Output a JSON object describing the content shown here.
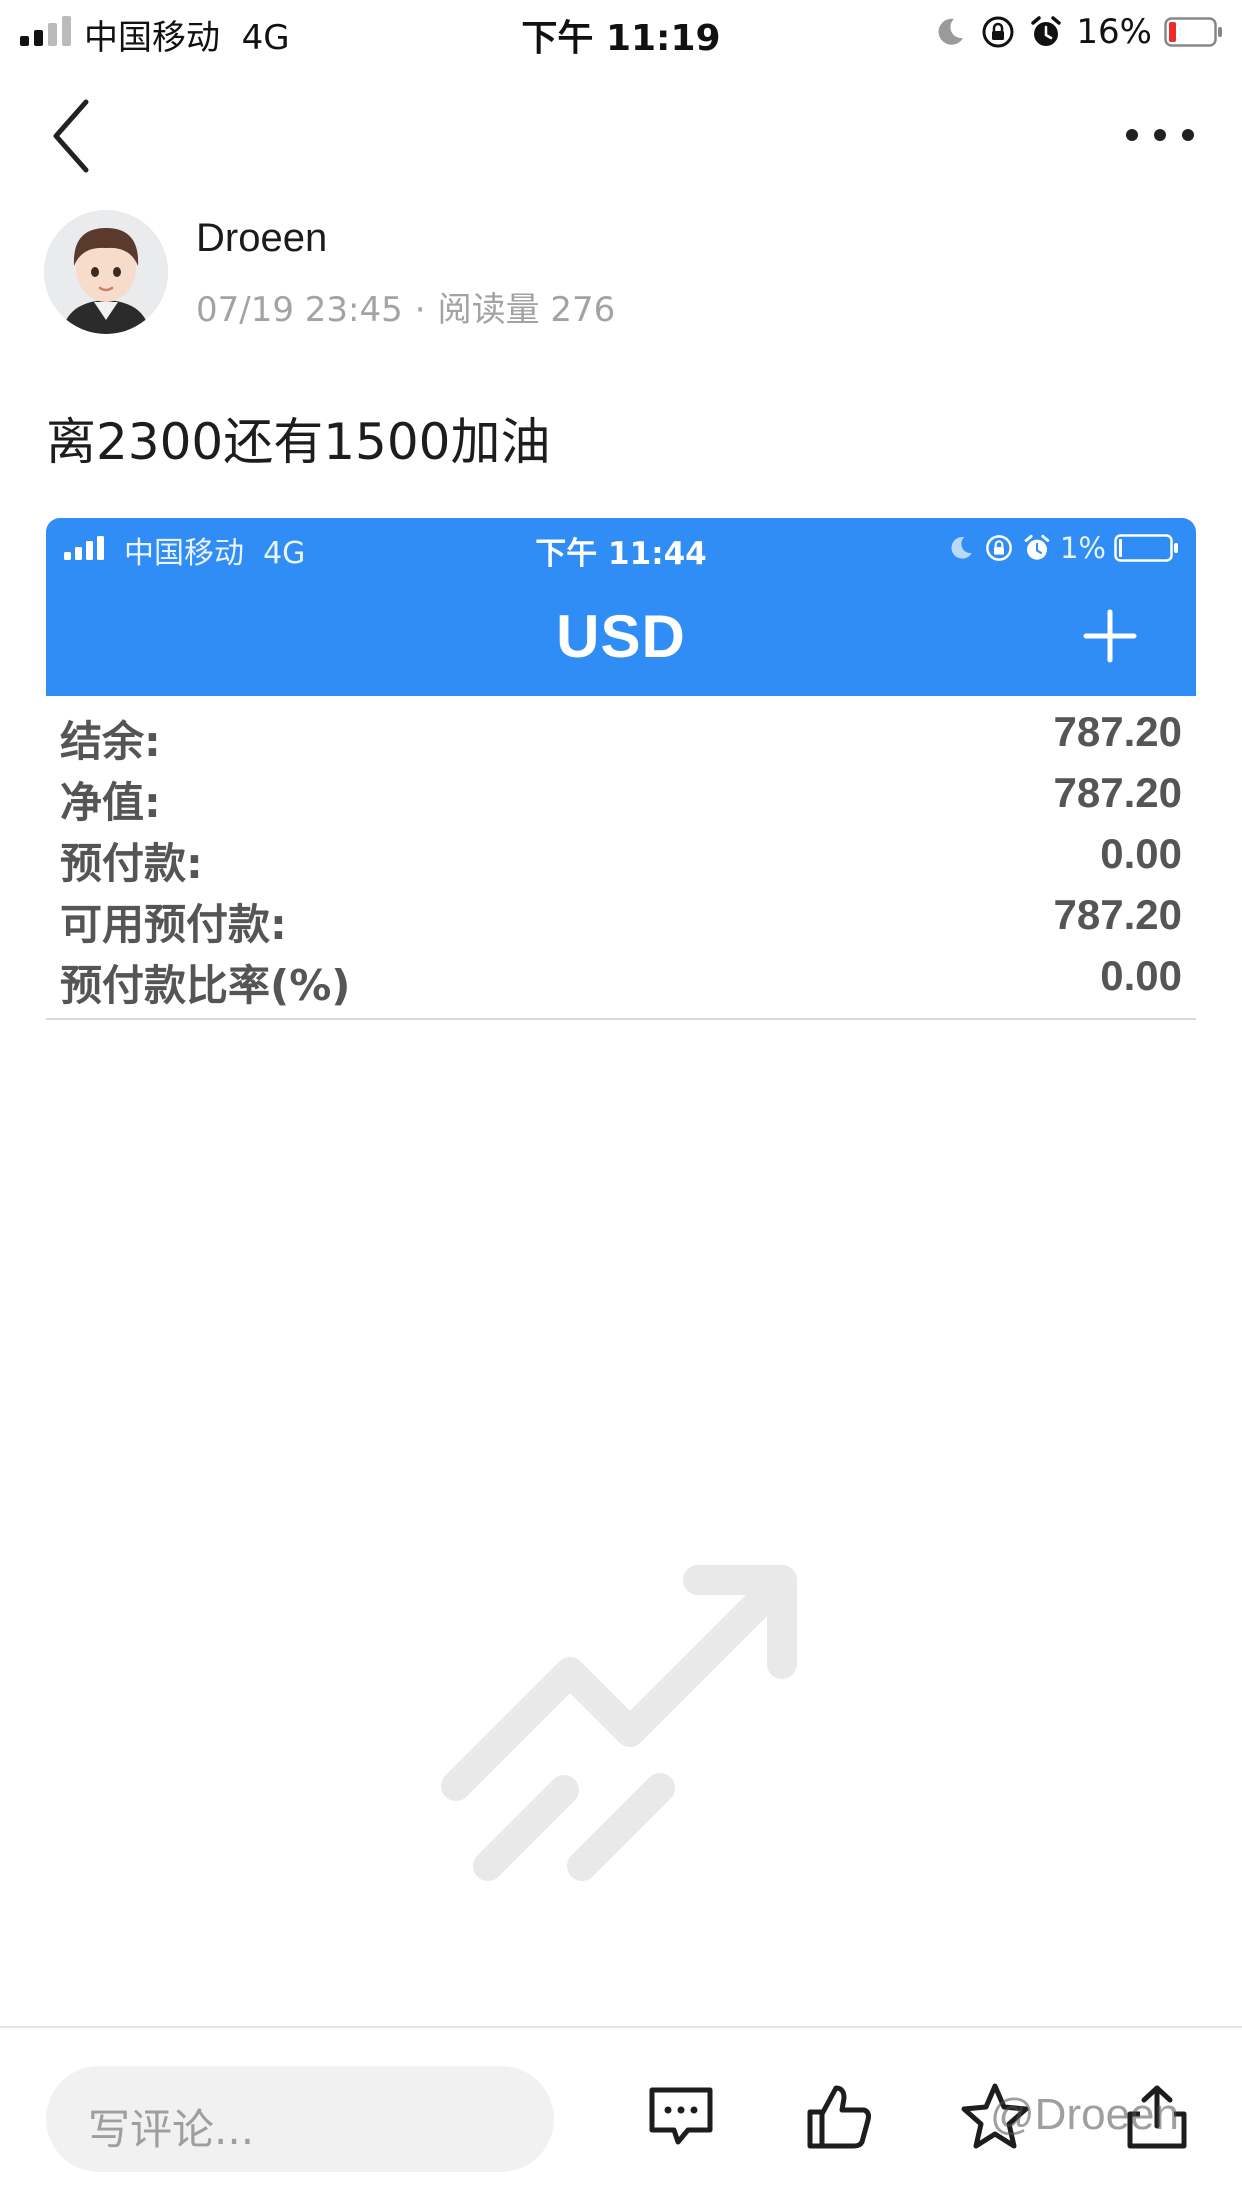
{
  "status_bar": {
    "carrier": "中国移动",
    "network": "4G",
    "time": "下午 11:19",
    "battery": "16%"
  },
  "post": {
    "author": "Droeen",
    "date": "07/19 23:45",
    "separator": "·",
    "reads_label": "阅读量 276",
    "text": "离2300还有1500加油"
  },
  "embedded_screenshot": {
    "status_bar": {
      "carrier": "中国移动",
      "network": "4G",
      "time": "下午 11:44",
      "battery": "1%"
    },
    "title": "USD",
    "rows": [
      {
        "label": "结余:",
        "value": "787.20"
      },
      {
        "label": "净值:",
        "value": "787.20"
      },
      {
        "label": "预付款:",
        "value": "0.00"
      },
      {
        "label": "可用预付款:",
        "value": "787.20"
      },
      {
        "label": "预付款比率(%)",
        "value": "0.00"
      }
    ],
    "accent_color": "#2f8df5"
  },
  "bottom_bar": {
    "comment_placeholder": "写评论...",
    "watermark": "@Droeen"
  }
}
